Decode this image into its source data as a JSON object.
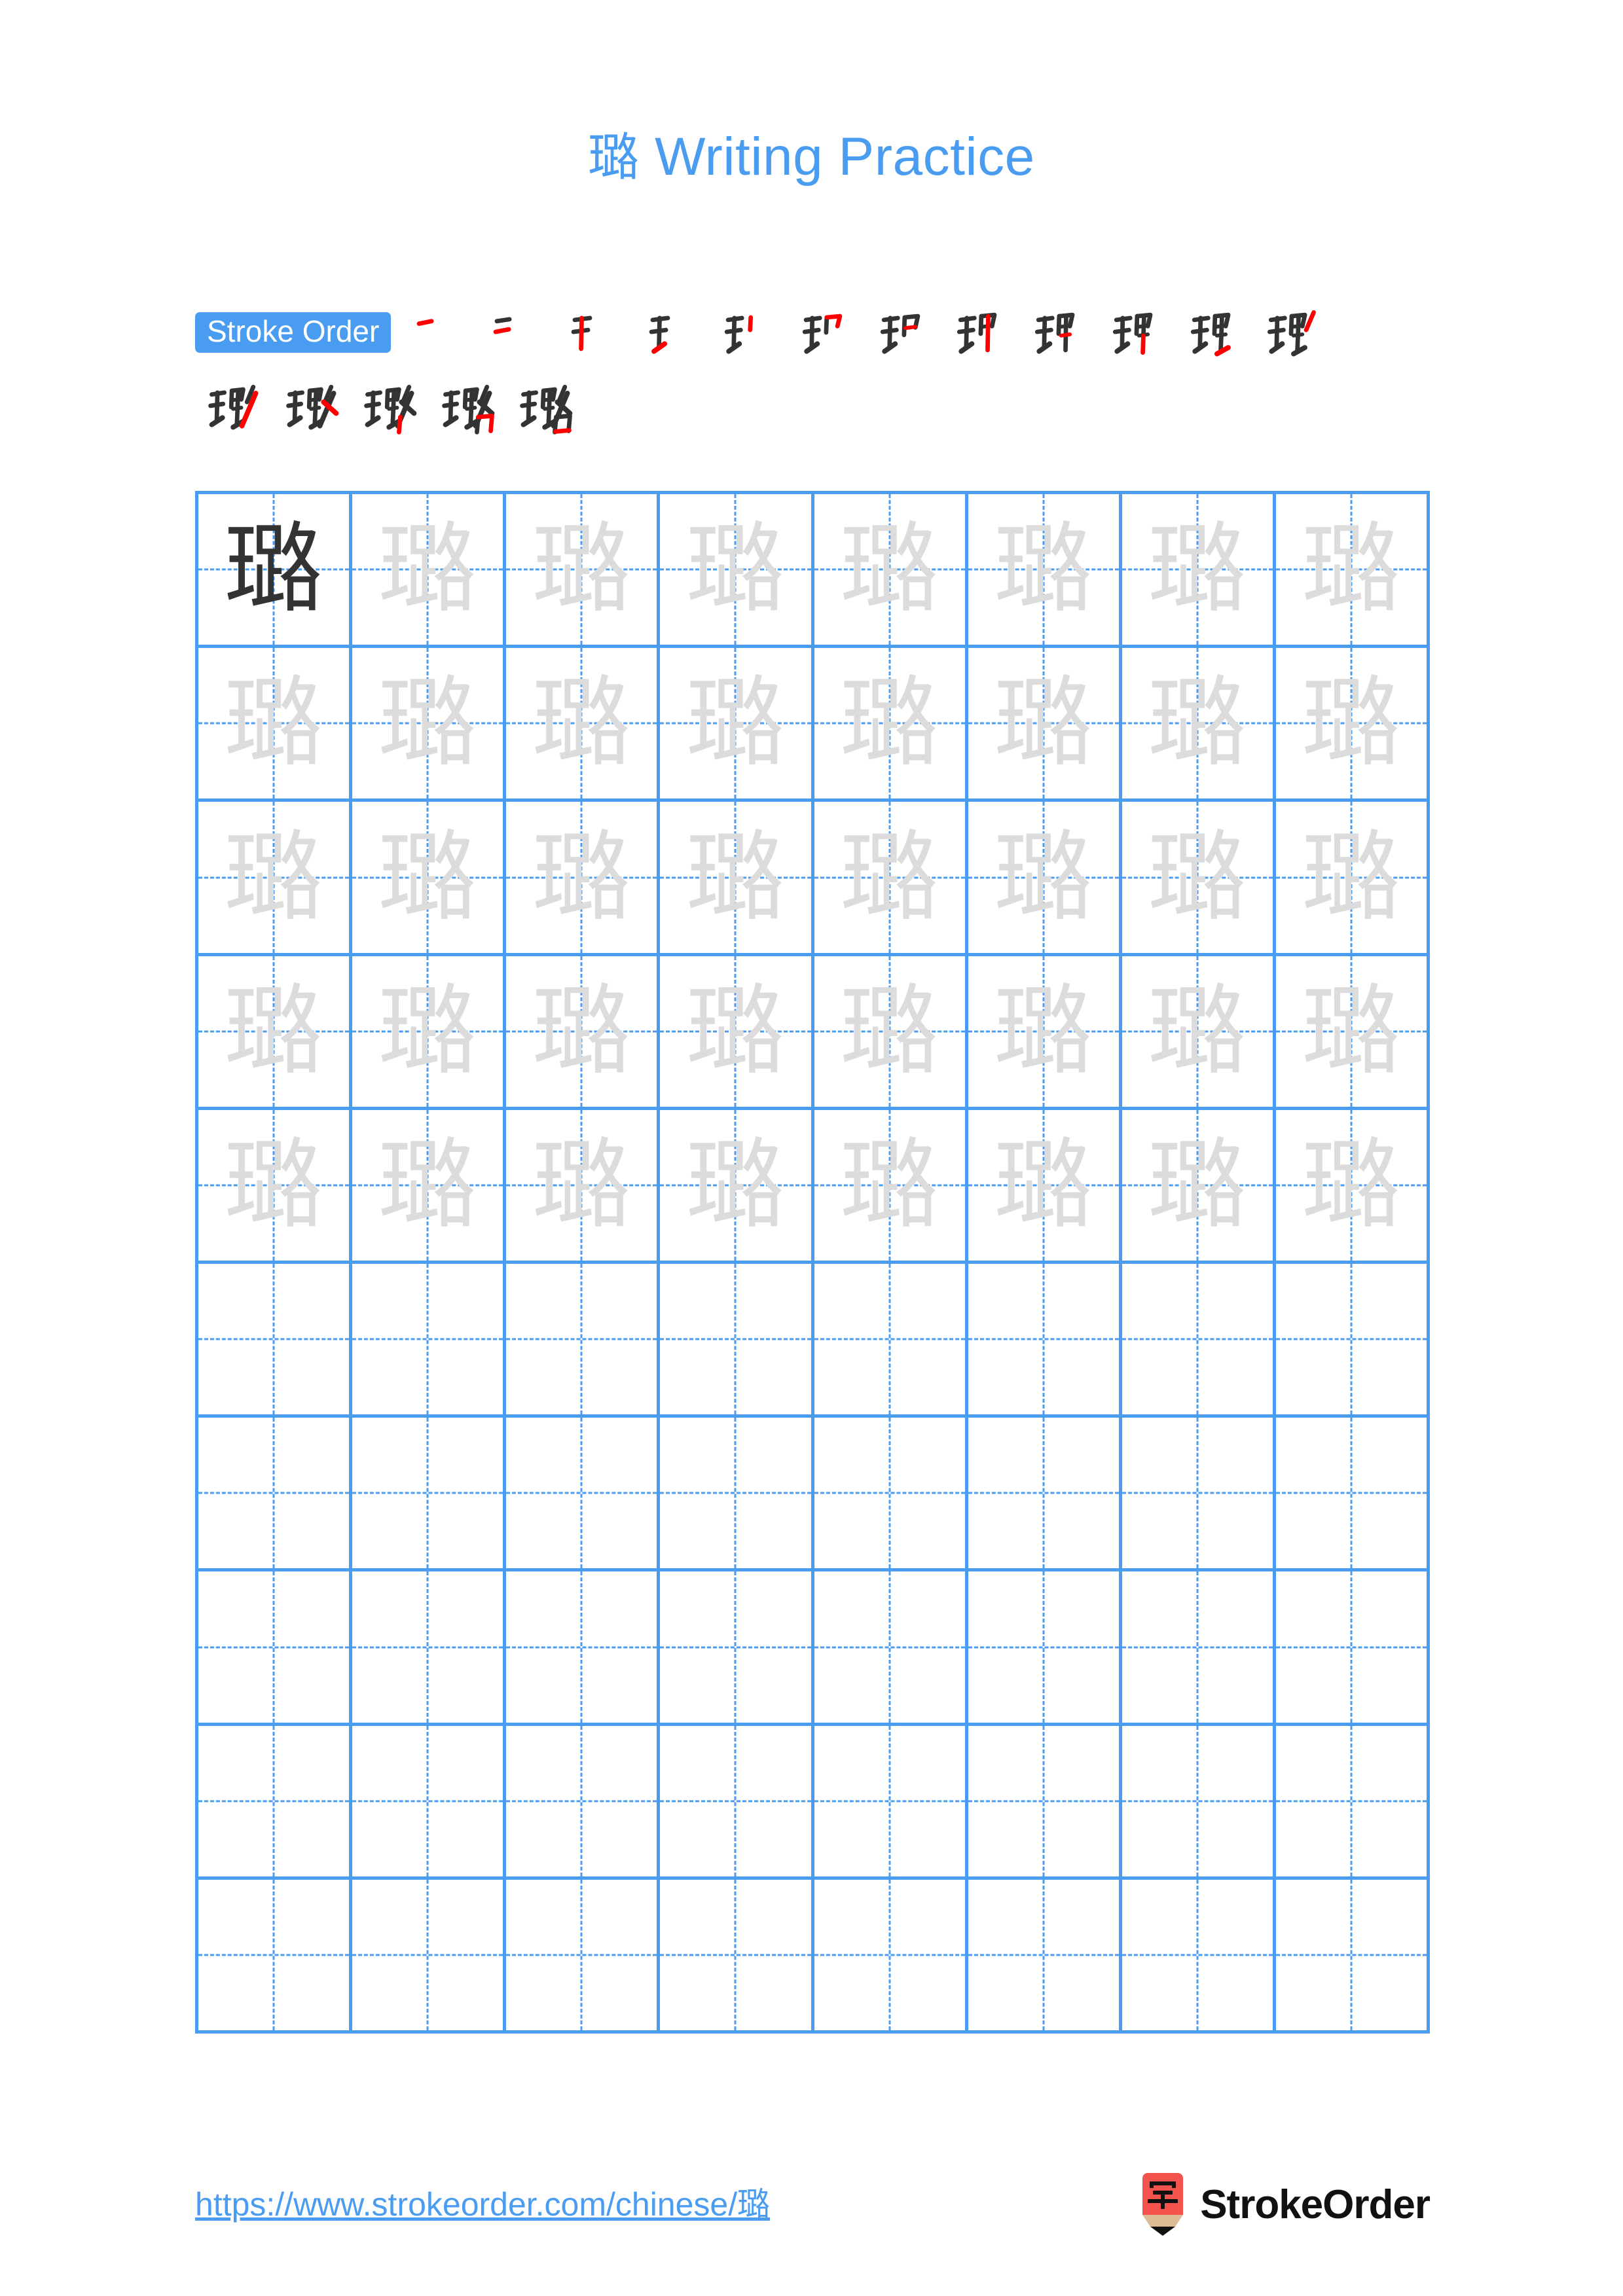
{
  "page": {
    "character": "璐",
    "title_prefix": "璐",
    "title_text": " Writing Practice",
    "title_full": "璐 Writing Practice",
    "accent_color": "#4a9cf0",
    "grid_line_color": "#4a9cf0",
    "template_char_color": "#dcdcdc",
    "model_char_color": "#333333",
    "stroke_new_color": "#ff0000",
    "stroke_old_color": "#333333"
  },
  "stroke_order": {
    "label": "Stroke Order",
    "total_strokes": 17,
    "row1_count": 12,
    "row2_count": 5,
    "steps": [
      {
        "index": 1,
        "char": "一"
      },
      {
        "index": 2,
        "char": "二"
      },
      {
        "index": 3,
        "char": "干"
      },
      {
        "index": 4,
        "char": "王"
      },
      {
        "index": 5,
        "char": "𤣩"
      },
      {
        "index": 6,
        "char": "𤣩"
      },
      {
        "index": 7,
        "char": "珇"
      },
      {
        "index": 8,
        "char": "珇"
      },
      {
        "index": 9,
        "char": "珡"
      },
      {
        "index": 10,
        "char": "珡"
      },
      {
        "index": 11,
        "char": "珡"
      },
      {
        "index": 12,
        "char": "珡"
      },
      {
        "index": 13,
        "char": "璐"
      },
      {
        "index": 14,
        "char": "璐"
      },
      {
        "index": 15,
        "char": "璐"
      },
      {
        "index": 16,
        "char": "璐"
      },
      {
        "index": 17,
        "char": "璐"
      }
    ]
  },
  "grid": {
    "columns": 8,
    "rows": 10,
    "filled_rows": 5,
    "empty_rows": 5,
    "model_cell": {
      "row": 1,
      "col": 1
    }
  },
  "footer": {
    "url": "https://www.strokeorder.com/chinese/璐",
    "logo_text": "StrokeOrder",
    "logo_char": "字",
    "logo_body_color": "#f2534d",
    "logo_wood_color": "#ddbb94",
    "logo_tip_color": "#111111"
  }
}
